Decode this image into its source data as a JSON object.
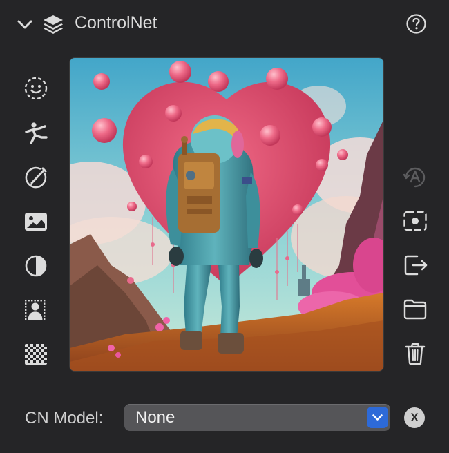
{
  "header": {
    "title": "ControlNet",
    "collapse_icon": "chevron-down-icon",
    "section_icon": "layers-icon",
    "help_icon": "help-circle-icon"
  },
  "left_toolbar": [
    {
      "icon": "face-detect-icon"
    },
    {
      "icon": "pose-icon"
    },
    {
      "icon": "scribble-icon"
    },
    {
      "icon": "image-icon"
    },
    {
      "icon": "contrast-icon"
    },
    {
      "icon": "person-segmentation-icon"
    },
    {
      "icon": "checkerboard-icon"
    }
  ],
  "right_toolbar": [
    {
      "icon": "auto-annotate-icon",
      "enabled": false
    },
    {
      "icon": "capture-canvas-icon",
      "enabled": true
    },
    {
      "icon": "export-icon",
      "enabled": true
    },
    {
      "icon": "folder-icon",
      "enabled": true
    },
    {
      "icon": "trash-icon",
      "enabled": true
    }
  ],
  "preview": {
    "content": "astronaut-with-heart-balloons-image"
  },
  "model_picker": {
    "label": "CN Model:",
    "selected": "None",
    "clear_label": "X"
  },
  "colors": {
    "background": "#252527",
    "icon": "#dcdcdc",
    "icon_disabled": "#5c5c5e",
    "select_bg": "#555558",
    "accent": "#2d6ad8"
  }
}
